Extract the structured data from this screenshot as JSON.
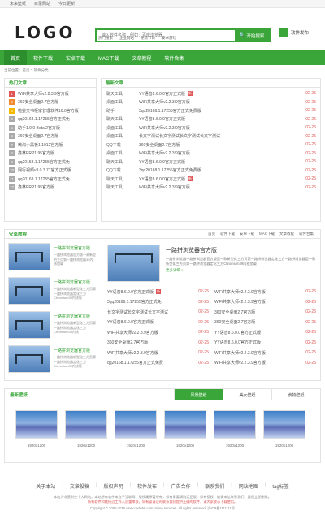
{
  "topbar": [
    "未来壁纸",
    "目录网站",
    "今日更新"
  ],
  "logo": "LOGO",
  "search": {
    "placeholder": "输入软件名称，例如：百度浏览器",
    "button": "开始搜索"
  },
  "hot": [
    "热门搜索",
    "企业网站",
    "免费节日",
    "安卓游戏"
  ],
  "publish": "软件发布",
  "nav": [
    "首页",
    "软件下载",
    "安卓下载",
    "MAC下载",
    "文章教程",
    "软件合集"
  ],
  "breadcrumb": "当前位置：首页 > 软件分类",
  "hot_box": {
    "title": "热门文章",
    "items": [
      {
        "n": "1",
        "c": "#e05555",
        "t": "WiFi共享大师v2.2.3.9官方版"
      },
      {
        "n": "2",
        "c": "#f08a30",
        "t": "360安全桌面2.7官方版"
      },
      {
        "n": "3",
        "c": "#f5b800",
        "t": "啦委交书柜家曾理软件10.0官方版"
      },
      {
        "n": "4",
        "c": "#aaaaaa",
        "t": "qq20168.1.17255官方正式免"
      },
      {
        "n": "5",
        "c": "#aaaaaa",
        "t": "助手1.0.0 Beta 2官方版"
      },
      {
        "n": "6",
        "c": "#aaaaaa",
        "t": "360安全桌面2.7官方版"
      },
      {
        "n": "7",
        "c": "#aaaaaa",
        "t": "微淘小黑板1.1012官方版"
      },
      {
        "n": "8",
        "c": "#aaaaaa",
        "t": "鑫林ERP1.95官方版"
      },
      {
        "n": "9",
        "c": "#aaaaaa",
        "t": "qq20158.1.17255官方正式免"
      },
      {
        "n": "10",
        "c": "#aaaaaa",
        "t": "网行视频v3.0.3.77官方正式版"
      },
      {
        "n": "11",
        "c": "#aaaaaa",
        "t": "qq20168.1.17255官方正式免"
      },
      {
        "n": "12",
        "c": "#aaaaaa",
        "t": "鑫林ERP1.95官方版"
      }
    ]
  },
  "latest": {
    "title": "最新文章",
    "items": [
      {
        "cat": "聊天工具",
        "t": "YY语音8.6.0.0官方正式版",
        "d": "02-25",
        "n": true
      },
      {
        "cat": "桌面工具",
        "t": "WiFi共享大师v2.2.3.9官方版",
        "d": "02-25"
      },
      {
        "cat": "助手",
        "t": "3qq20168.1.17255官方正式免费版",
        "d": "02-25"
      },
      {
        "cat": "聊天工具",
        "t": "YY语音8.6.0.0官方正式版",
        "d": "02-25"
      },
      {
        "cat": "桌面工具",
        "t": "WiFi共享大师v2.2.3.9官方版",
        "d": "02-25"
      },
      {
        "cat": "桌面工具",
        "t": "长文字测试长文字测试长文字测试长文字测试",
        "d": "02-25"
      },
      {
        "cat": "QQ下载",
        "t": "360安全桌面2.7官方版",
        "d": "02-25"
      },
      {
        "cat": "桌面工具",
        "t": "WiFi共享大师v2.2.3.9官方版",
        "d": "02-25"
      },
      {
        "cat": "聊天工具",
        "t": "YY语音8.6.0.0官方正式版",
        "d": "02-25"
      },
      {
        "cat": "QQ下载",
        "t": "3qq20168.1.17255官方正式免费版",
        "d": "02-25"
      },
      {
        "cat": "聊天工具",
        "t": "YY语音8.6.0.0官方正式版",
        "d": "02-25",
        "n": true
      },
      {
        "cat": "聊天工具",
        "t": "WiFi共享大师v2.2.3.9官方版",
        "d": "02-25"
      }
    ]
  },
  "tutorial": {
    "title": "安卓教程",
    "tabs": [
      "首页",
      "软件下载",
      "安卓下载",
      "MAC下载",
      "文章教程",
      "软件合集"
    ],
    "cards": [
      {
        "title": "一路拼浏览器官方版",
        "desc": "一路拼浏览器官方版一款新型的主页第一路拼浏览器39内核加载"
      },
      {
        "title": "一路拼浏览器官方版",
        "desc": "一路拼浏览器新型化三方页第一路拼浏览器定化三方Chromium39内核版"
      },
      {
        "title": "一路拼浏览器官方版",
        "desc": "一路拼浏览器新型化三方页第一路拼浏览器定化三方Chromium39内核"
      },
      {
        "title": "一路拼浏览器官方版",
        "desc": "一路拼浏览器新型化三方页第一路拼浏览器定化三方Chromium39内核版"
      }
    ],
    "feature": {
      "title": "一路拼浏览器官方版",
      "desc": "一路拼浏览器一路拼浏览器官方版是一款新型化三方页第一路拼浏览器定化三方一路拼浏览器是一款新型化三方页第一路拼浏览器定化三方Chromium39内核加载",
      "more": "更多详细 >"
    },
    "left": [
      {
        "t": "YY语音8.6.0.0官方正式版",
        "d": "02-25",
        "n": true
      },
      {
        "t": "3qq20168.1.17255官方正式免",
        "d": "02-25"
      },
      {
        "t": "长文字测试长文字测试长文字测试",
        "d": "02-25"
      },
      {
        "t": "YY语音8.6.0.0官方正式版",
        "d": "02-25"
      },
      {
        "t": "WiFi共享大师v2.2.3.9官方版",
        "d": "02-25"
      },
      {
        "t": "360安全桌面2.7官方版",
        "d": "02-25"
      },
      {
        "t": "WiFi共享大师v2.2.3.9官方版",
        "d": "02-25"
      },
      {
        "t": "qq20168.1.17255官方正式免费",
        "d": "02-25"
      }
    ],
    "right": [
      {
        "t": "WiFi共享大师v2.2.3.9官方版",
        "d": "02-25"
      },
      {
        "t": "WiFi共享大师v2.2.3.9官方版",
        "d": "02-25"
      },
      {
        "t": "360安全桌面2.7官方版",
        "d": "02-25"
      },
      {
        "t": "360安全桌面2.7官方版",
        "d": "02-25"
      },
      {
        "t": "YY语音8.6.0.0官方正式版",
        "d": "02-25"
      },
      {
        "t": "YY语音8.6.0.0官方正式版",
        "d": "02-25"
      },
      {
        "t": "WiFi共享大师v2.2.3.9官方版",
        "d": "02-25"
      },
      {
        "t": "WiFi共享大师v2.2.3.9官方版",
        "d": "02-25"
      }
    ]
  },
  "wall": {
    "title": "最新壁纸",
    "tabs": [
      "风景壁纸",
      "美女壁纸",
      "食物壁纸"
    ],
    "sizes": [
      "1920x1200",
      "1920x1200",
      "1920x1200",
      "1920x1200",
      "1920x1200",
      "1920x1200"
    ]
  },
  "footer": {
    "links": [
      "关于本站",
      "文章投稿",
      "版权声明",
      "软件发布",
      "广告合作",
      "联系我们",
      "网站地图",
      "tag标签"
    ],
    "line1": "本站为非营利性个人网站，本站所有软件来自于互联网，版权属原著所有，如有需要请购买正版。如有侵权，敬请来信联系我们，我们立即删除。",
    "line2": "所有软件和链接过工作人员重审核，如有误请及时联系我们提供正确的软件，请大家放心下载使用。",
    "copy": "Copyright © 2005-2015 www.dede58.com online services. All rights reserved. 沪ICP备1111111号"
  }
}
